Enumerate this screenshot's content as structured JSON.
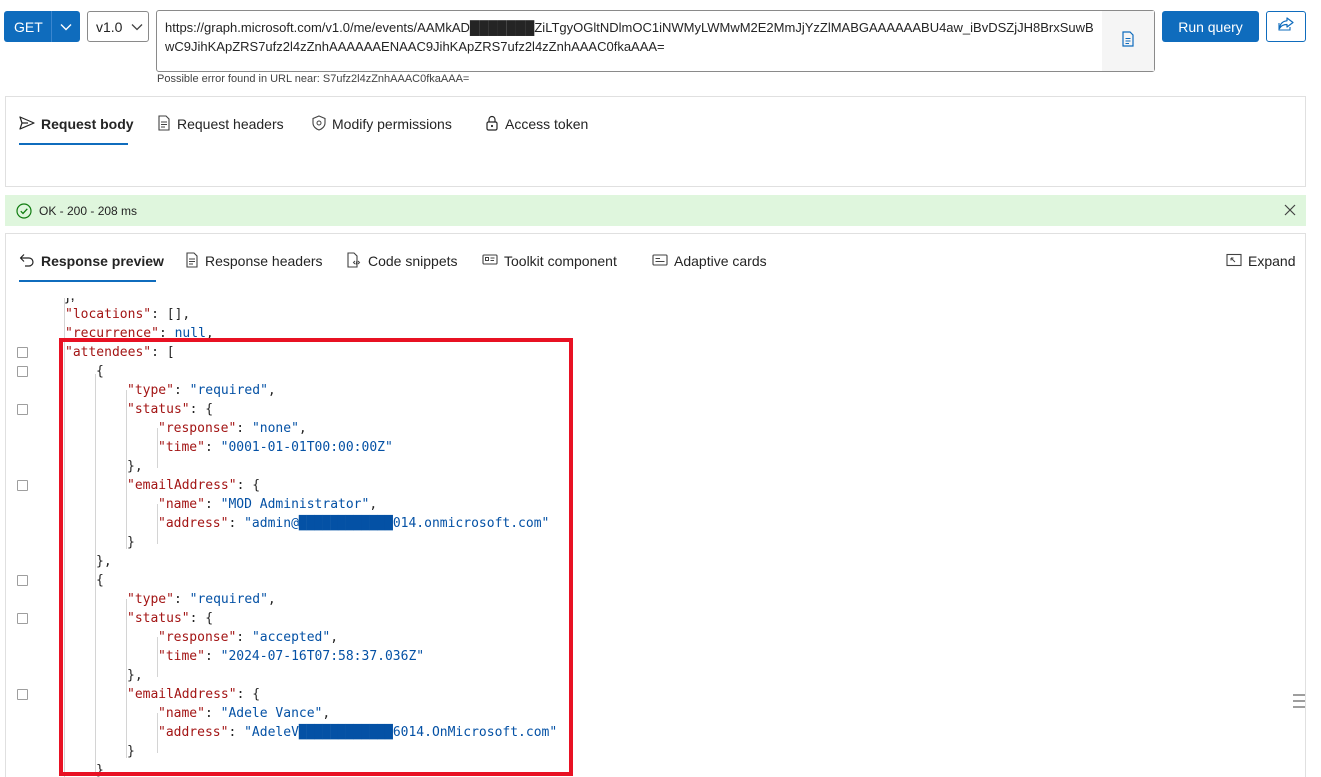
{
  "query": {
    "method": "GET",
    "version": "v1.0",
    "url": "https://graph.microsoft.com/v1.0/me/events/AAMkAD███████ZiLTgyOGltNDlmOC1iNWMyLWMwM2E2MmJjYzZlMABGAAAAAABU4aw_iBvDSZjJH8BrxSuwBwC9JihKApZRS7ufz2l4zZnhAAAAAAENAAC9JihKApZRS7ufz2l4zZnhAAAC0fkaAAA=",
    "url_warning": "Possible error found in URL near: S7ufz2l4zZnhAAAC0fkaAAA=",
    "run_label": "Run query",
    "copy_icon": "document-copy-icon",
    "share_icon": "share-icon"
  },
  "request_tabs": [
    {
      "label": "Request body",
      "icon": "send-icon",
      "active": true
    },
    {
      "label": "Request headers",
      "icon": "document-icon",
      "active": false
    },
    {
      "label": "Modify permissions",
      "icon": "shield-icon",
      "active": false
    },
    {
      "label": "Access token",
      "icon": "lock-icon",
      "active": false
    }
  ],
  "status": {
    "text": "OK - 200 - 208 ms",
    "color": "#dff6dd",
    "icon": "check-circle-icon"
  },
  "response_tabs": [
    {
      "label": "Response preview",
      "icon": "undo-icon",
      "active": true
    },
    {
      "label": "Response headers",
      "icon": "document-icon",
      "active": false
    },
    {
      "label": "Code snippets",
      "icon": "code-file-icon",
      "active": false
    },
    {
      "label": "Toolkit component",
      "icon": "toolkit-icon",
      "active": false
    },
    {
      "label": "Adaptive cards",
      "icon": "card-icon",
      "active": false
    }
  ],
  "expand_label": "Expand",
  "json_lines": [
    {
      "indent": 1,
      "key": "locations",
      "sep": ": ",
      "val": "[]",
      "vtype": "p",
      "end": ","
    },
    {
      "indent": 1,
      "key": "recurrence",
      "sep": ": ",
      "val": "null",
      "vtype": "kw",
      "end": ","
    },
    {
      "indent": 1,
      "key": "attendees",
      "sep": ": ",
      "val": "[",
      "vtype": "p",
      "end": "",
      "fold": true
    },
    {
      "indent": 2,
      "punct": "{",
      "fold": true
    },
    {
      "indent": 3,
      "key": "type",
      "sep": ": ",
      "val": "\"required\"",
      "vtype": "s",
      "end": ","
    },
    {
      "indent": 3,
      "key": "status",
      "sep": ": ",
      "val": "{",
      "vtype": "p",
      "end": "",
      "fold": true
    },
    {
      "indent": 4,
      "key": "response",
      "sep": ": ",
      "val": "\"none\"",
      "vtype": "s",
      "end": ","
    },
    {
      "indent": 4,
      "key": "time",
      "sep": ": ",
      "val": "\"0001-01-01T00:00:00Z\"",
      "vtype": "s",
      "end": ""
    },
    {
      "indent": 3,
      "punct": "},"
    },
    {
      "indent": 3,
      "key": "emailAddress",
      "sep": ": ",
      "val": "{",
      "vtype": "p",
      "end": "",
      "fold": true
    },
    {
      "indent": 4,
      "key": "name",
      "sep": ": ",
      "val": "\"MOD Administrator\"",
      "vtype": "s",
      "end": ","
    },
    {
      "indent": 4,
      "key": "address",
      "sep": ": ",
      "val": "\"admin@████████████014.onmicrosoft.com\"",
      "vtype": "s",
      "end": ""
    },
    {
      "indent": 3,
      "punct": "}"
    },
    {
      "indent": 2,
      "punct": "},"
    },
    {
      "indent": 2,
      "punct": "{",
      "fold": true
    },
    {
      "indent": 3,
      "key": "type",
      "sep": ": ",
      "val": "\"required\"",
      "vtype": "s",
      "end": ","
    },
    {
      "indent": 3,
      "key": "status",
      "sep": ": ",
      "val": "{",
      "vtype": "p",
      "end": "",
      "fold": true
    },
    {
      "indent": 4,
      "key": "response",
      "sep": ": ",
      "val": "\"accepted\"",
      "vtype": "s",
      "end": ","
    },
    {
      "indent": 4,
      "key": "time",
      "sep": ": ",
      "val": "\"2024-07-16T07:58:37.036Z\"",
      "vtype": "s",
      "end": ""
    },
    {
      "indent": 3,
      "punct": "},"
    },
    {
      "indent": 3,
      "key": "emailAddress",
      "sep": ": ",
      "val": "{",
      "vtype": "p",
      "end": "",
      "fold": true
    },
    {
      "indent": 4,
      "key": "name",
      "sep": ": ",
      "val": "\"Adele Vance\"",
      "vtype": "s",
      "end": ","
    },
    {
      "indent": 4,
      "key": "address",
      "sep": ": ",
      "val": "\"AdeleV████████████6014.OnMicrosoft.com\"",
      "vtype": "s",
      "end": ""
    },
    {
      "indent": 3,
      "punct": "}"
    },
    {
      "indent": 2,
      "punct": "},"
    }
  ],
  "annotation_color": "#e81123"
}
